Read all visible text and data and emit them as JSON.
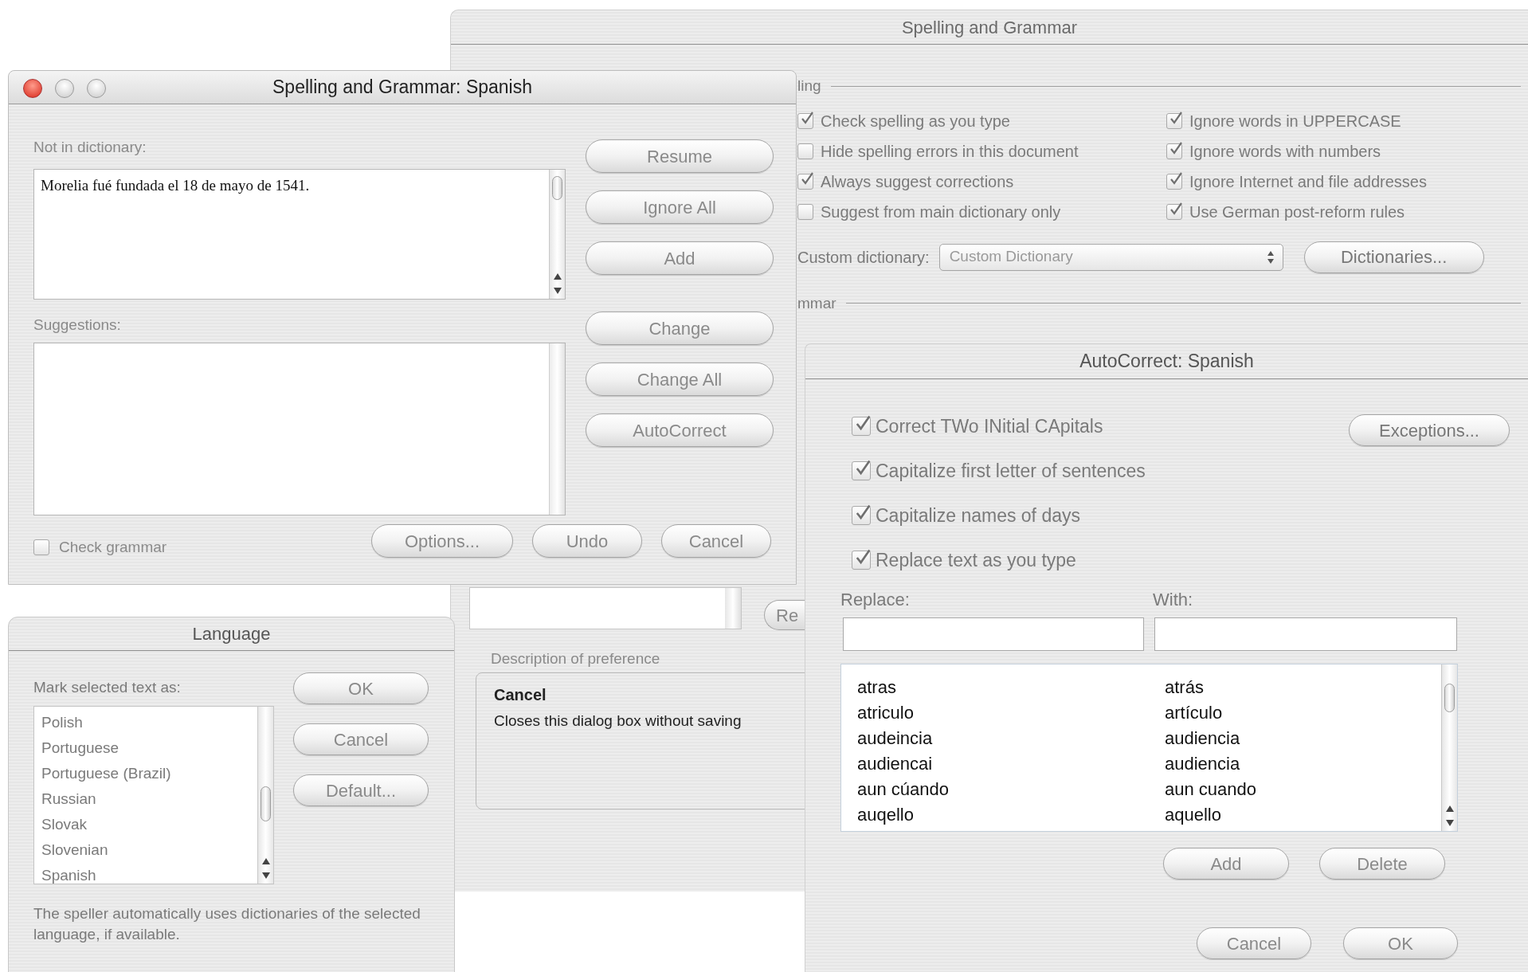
{
  "preferences_window": {
    "title": "Spelling and Grammar",
    "spelling_section": "ling",
    "options_left": [
      {
        "label": "Check spelling as you type",
        "checked": true
      },
      {
        "label": "Hide spelling errors in this document",
        "checked": false
      },
      {
        "label": "Always suggest corrections",
        "checked": true
      },
      {
        "label": "Suggest from main dictionary only",
        "checked": false
      }
    ],
    "options_right": [
      {
        "label": "Ignore words in UPPERCASE",
        "checked": true
      },
      {
        "label": "Ignore words with numbers",
        "checked": true
      },
      {
        "label": "Ignore Internet and file addresses",
        "checked": true
      },
      {
        "label": "Use German post-reform rules",
        "checked": true
      }
    ],
    "custom_dictionary": {
      "label": "Custom dictionary:",
      "value": "Custom Dictionary"
    },
    "dictionaries_button": "Dictionaries...",
    "grammar_section": "mmar",
    "partial_button": "Re",
    "description": {
      "label": "Description of preference",
      "title": "Cancel",
      "text": "Closes this dialog box without saving"
    }
  },
  "spelling_dialog": {
    "title": "Spelling and Grammar: Spanish",
    "not_in_dictionary_label": "Not in dictionary:",
    "sentence": "Morelia fué fundada el 18 de mayo de 1541.",
    "suggestions_label": "Suggestions:",
    "side_buttons": [
      "Resume",
      "Ignore All",
      "Add",
      "Change",
      "Change All",
      "AutoCorrect"
    ],
    "check_grammar": {
      "label": "Check grammar",
      "checked": false
    },
    "bottom_buttons": [
      "Options...",
      "Undo",
      "Cancel"
    ]
  },
  "language_dialog": {
    "title": "Language",
    "list_label": "Mark selected text as:",
    "languages": [
      "Polish",
      "Portuguese",
      "Portuguese (Brazil)",
      "Russian",
      "Slovak",
      "Slovenian",
      "Spanish"
    ],
    "buttons": [
      "OK",
      "Cancel",
      "Default..."
    ],
    "note": "The speller automatically uses dictionaries of the selected language, if available."
  },
  "autocorrect_dialog": {
    "title": "AutoCorrect: Spanish",
    "options": [
      {
        "label": "Correct TWo INitial CApitals",
        "checked": true
      },
      {
        "label": "Capitalize first letter of sentences",
        "checked": true
      },
      {
        "label": "Capitalize names of days",
        "checked": true
      },
      {
        "label": "Replace text as you type",
        "checked": true
      }
    ],
    "exceptions_button": "Exceptions...",
    "replace_label": "Replace:",
    "with_label": "With:",
    "entries": [
      {
        "replace": "atras",
        "with": "atrás"
      },
      {
        "replace": "atriculo",
        "with": "artículo"
      },
      {
        "replace": "audeincia",
        "with": "audiencia"
      },
      {
        "replace": "audiencai",
        "with": "audiencia"
      },
      {
        "replace": "aun cúando",
        "with": "aun cuando"
      },
      {
        "replace": "auqello",
        "with": "aquello"
      }
    ],
    "list_buttons": [
      "Add",
      "Delete"
    ],
    "buttons": [
      "Cancel",
      "OK"
    ]
  }
}
